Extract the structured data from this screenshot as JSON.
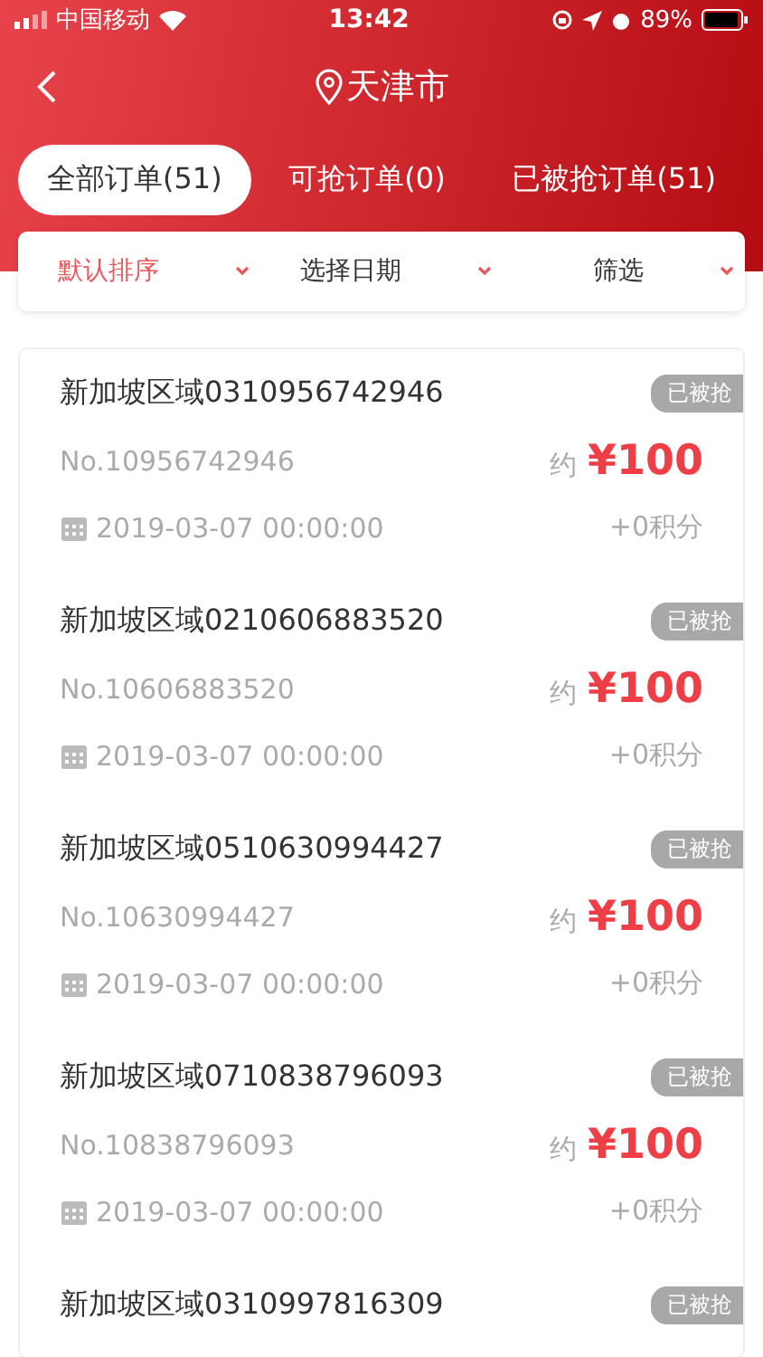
{
  "status_bar": {
    "carrier": "中国移动",
    "time": "13:42",
    "battery": "89%"
  },
  "nav": {
    "title": "天津市"
  },
  "tabs": [
    {
      "label": "全部订单(51)",
      "selected": true
    },
    {
      "label": "可抢订单(0)",
      "selected": false
    },
    {
      "label": "已被抢订单(51)",
      "selected": false
    }
  ],
  "filters": [
    {
      "label": "默认排序",
      "selected": true
    },
    {
      "label": "选择日期",
      "selected": false
    },
    {
      "label": "筛选",
      "selected": false
    }
  ],
  "orders": [
    {
      "title": "新加坡区域0310956742946",
      "badge": "已被抢",
      "number": "No.10956742946",
      "approx": "约",
      "price": "¥100",
      "date": "2019-03-07 00:00:00",
      "points": "+0积分"
    },
    {
      "title": "新加坡区域0210606883520",
      "badge": "已被抢",
      "number": "No.10606883520",
      "approx": "约",
      "price": "¥100",
      "date": "2019-03-07 00:00:00",
      "points": "+0积分"
    },
    {
      "title": "新加坡区域0510630994427",
      "badge": "已被抢",
      "number": "No.10630994427",
      "approx": "约",
      "price": "¥100",
      "date": "2019-03-07 00:00:00",
      "points": "+0积分"
    },
    {
      "title": "新加坡区域0710838796093",
      "badge": "已被抢",
      "number": "No.10838796093",
      "approx": "约",
      "price": "¥100",
      "date": "2019-03-07 00:00:00",
      "points": "+0积分"
    },
    {
      "title": "新加坡区域0310997816309",
      "badge": "已被抢"
    }
  ]
}
